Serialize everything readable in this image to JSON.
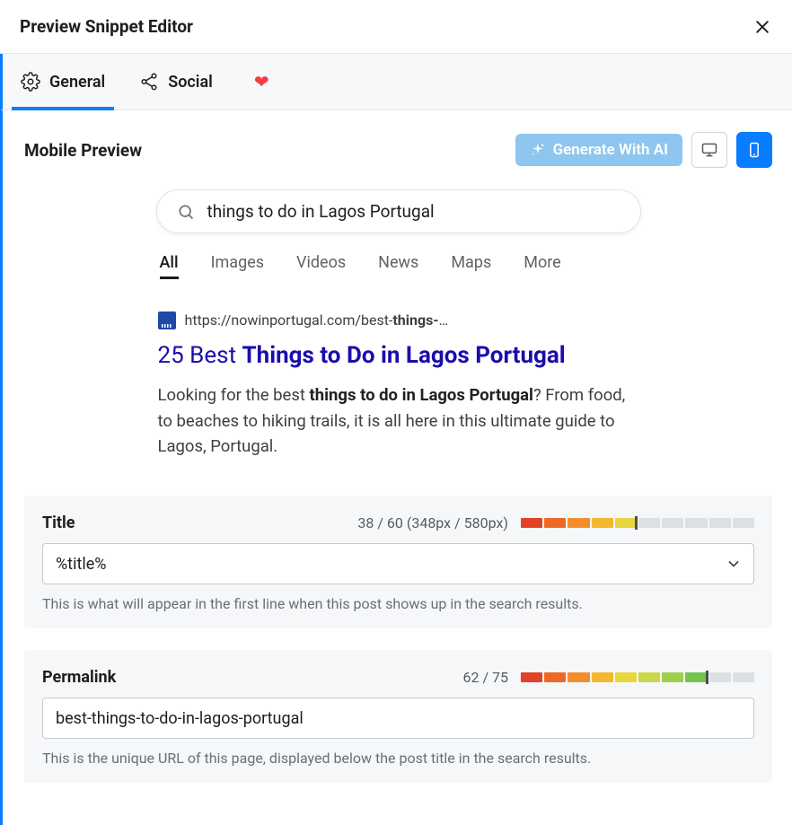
{
  "header": {
    "title": "Preview Snippet Editor"
  },
  "tabs": {
    "general": "General",
    "social": "Social"
  },
  "toolbar": {
    "section_title": "Mobile Preview",
    "ai_button": "Generate With AI"
  },
  "serp": {
    "query": "things to do in Lagos Portugal",
    "tabs": [
      "All",
      "Images",
      "Videos",
      "News",
      "Maps",
      "More"
    ],
    "result": {
      "url_prefix": "https://nowinportugal.com/best-",
      "url_bold": "things-",
      "url_suffix": "…",
      "title_plain": "25 Best ",
      "title_bold": "Things to Do in Lagos Portugal",
      "desc_pre": "Looking for the best ",
      "desc_bold": "things to do in Lagos Portugal",
      "desc_post": "? From food, to beaches to hiking trails, it is all here in this ultimate guide to Lagos, Portugal."
    }
  },
  "fields": {
    "title": {
      "label": "Title",
      "count": "38 / 60 (348px / 580px)",
      "value": "%title%",
      "help": "This is what will appear in the first line when this post shows up in the search results.",
      "segments": [
        "#e24228",
        "#ed6a26",
        "#f48e2a",
        "#f4b82f",
        "#e9d63f",
        "#dcdfe3",
        "#dcdfe3",
        "#dcdfe3",
        "#dcdfe3",
        "#dcdfe3"
      ],
      "marker_index": 4
    },
    "permalink": {
      "label": "Permalink",
      "count": "62 / 75",
      "value": "best-things-to-do-in-lagos-portugal",
      "help": "This is the unique URL of this page, displayed below the post title in the search results.",
      "segments": [
        "#e24228",
        "#ed6a26",
        "#f48e2a",
        "#f4b82f",
        "#e9d63f",
        "#c9d748",
        "#9fcf4d",
        "#72c44f",
        "#dcdfe3",
        "#dcdfe3"
      ],
      "marker_index": 7
    }
  }
}
